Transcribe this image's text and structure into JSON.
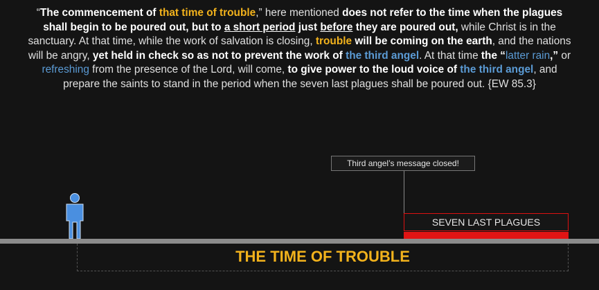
{
  "quote": {
    "segments": [
      {
        "t": "“",
        "c": "n"
      },
      {
        "t": "The commencement of ",
        "c": "b"
      },
      {
        "t": "that time of trouble",
        "c": "y"
      },
      {
        "t": ",” here mentioned ",
        "c": "n"
      },
      {
        "t": "does not refer to the time when the plagues shall begin to be poured out, but to ",
        "c": "b"
      },
      {
        "t": "a short period",
        "c": "u"
      },
      {
        "t": " just ",
        "c": "b"
      },
      {
        "t": "before",
        "c": "u"
      },
      {
        "t": " they are poured out,",
        "c": "b"
      },
      {
        "t": " while Christ is in the sanctuary. At that time, while the work of salvation is closing, ",
        "c": "n"
      },
      {
        "t": "trouble",
        "c": "y"
      },
      {
        "t": " will be coming on the earth",
        "c": "b"
      },
      {
        "t": ", and the nations will be angry, ",
        "c": "n"
      },
      {
        "t": "yet held in check so as not to prevent the work of ",
        "c": "b"
      },
      {
        "t": "the third angel",
        "c": "blb"
      },
      {
        "t": ". At that time ",
        "c": "n"
      },
      {
        "t": "the “",
        "c": "b"
      },
      {
        "t": "latter rain",
        "c": "bl"
      },
      {
        "t": ",” ",
        "c": "b"
      },
      {
        "t": "or ",
        "c": "n"
      },
      {
        "t": "refreshing",
        "c": "bl"
      },
      {
        "t": " from the presence of the Lord, will come, ",
        "c": "n"
      },
      {
        "t": "to give power to the loud voice of ",
        "c": "b"
      },
      {
        "t": "the third angel",
        "c": "blb"
      },
      {
        "t": ", and prepare the saints to stand in the period when the seven last plagues shall be poured out. {EW 85.3}",
        "c": "n"
      }
    ]
  },
  "callout": {
    "label": "Third angel’s message closed!"
  },
  "plagues": {
    "label": "SEVEN LAST PLAGUES",
    "color": "#e11414"
  },
  "timeline": {
    "label": "THE TIME OF TROUBLE",
    "label_color": "#f2b21c"
  },
  "person": {
    "icon": "person-icon",
    "color": "#4a8fe0"
  }
}
